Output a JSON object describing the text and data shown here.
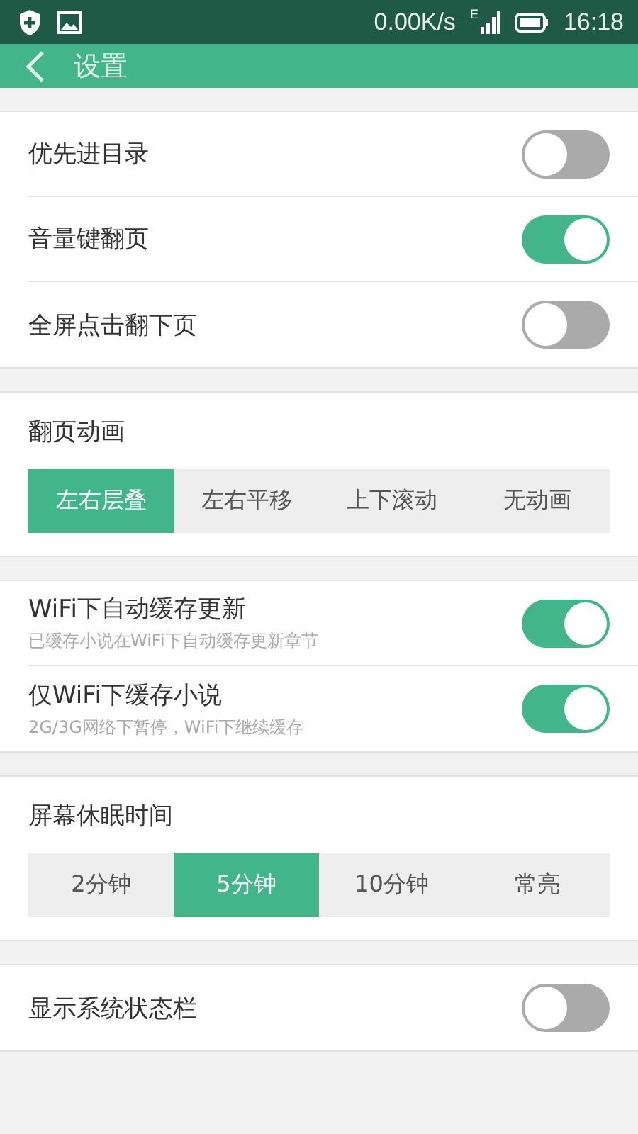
{
  "status_bar": {
    "speed": "0.00K/s",
    "network": "E",
    "time": "16:18"
  },
  "app_bar": {
    "title": "设置"
  },
  "sections": [
    {
      "kind": "toggles",
      "items": [
        {
          "label": "优先进目录",
          "on": false
        },
        {
          "label": "音量键翻页",
          "on": true
        },
        {
          "label": "全屏点击翻下页",
          "on": false
        }
      ]
    },
    {
      "kind": "segmented",
      "title": "翻页动画",
      "options": [
        {
          "label": "左右层叠",
          "selected": true
        },
        {
          "label": "左右平移",
          "selected": false
        },
        {
          "label": "上下滚动",
          "selected": false
        },
        {
          "label": "无动画",
          "selected": false
        }
      ]
    },
    {
      "kind": "toggles",
      "items": [
        {
          "label": "WiFi下自动缓存更新",
          "hint": "已缓存小说在WiFi下自动缓存更新章节",
          "on": true
        },
        {
          "label": "仅WiFi下缓存小说",
          "hint": "2G/3G网络下暂停，WiFi下继续缓存",
          "on": true
        }
      ]
    },
    {
      "kind": "segmented",
      "title": "屏幕休眠时间",
      "options": [
        {
          "label": "2分钟",
          "selected": false
        },
        {
          "label": "5分钟",
          "selected": true
        },
        {
          "label": "10分钟",
          "selected": false
        },
        {
          "label": "常亮",
          "selected": false
        }
      ]
    },
    {
      "kind": "toggles",
      "items": [
        {
          "label": "显示系统状态栏",
          "on": false
        }
      ]
    }
  ]
}
